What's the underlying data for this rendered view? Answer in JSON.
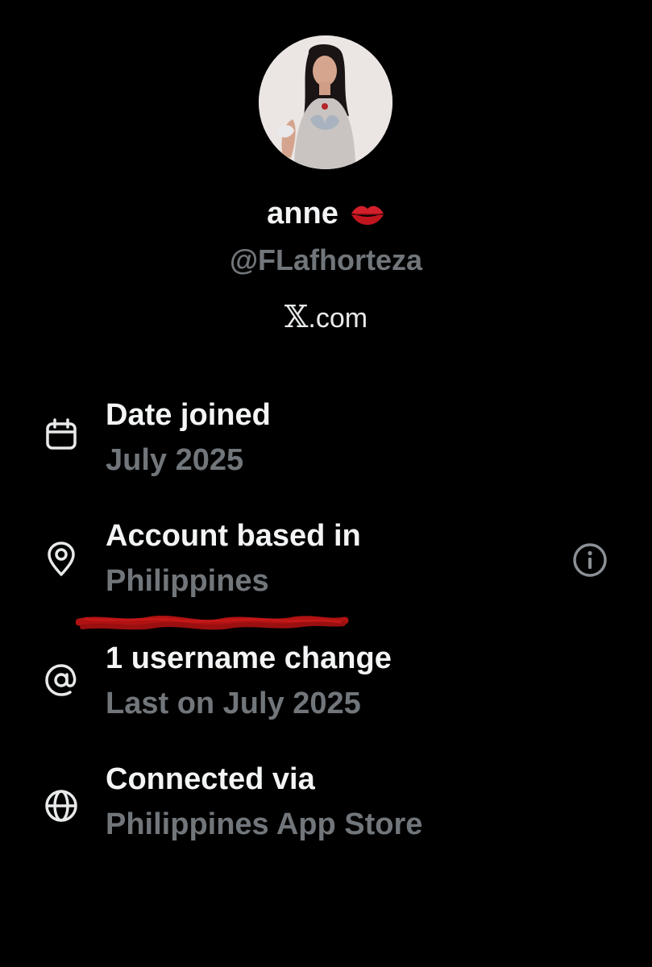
{
  "profile": {
    "display_name": "anne",
    "name_emoji": "kiss-mark-emoji",
    "handle": "@FLafhorteza",
    "site_mark": "𝕏",
    "site_text": ".com"
  },
  "details": [
    {
      "icon": "calendar-icon",
      "label": "Date joined",
      "value": "July 2025"
    },
    {
      "icon": "location-pin-icon",
      "label": "Account based in",
      "value": "Philippines"
    },
    {
      "icon": "at-sign-icon",
      "label": "1 username change",
      "value": "Last on July 2025"
    },
    {
      "icon": "globe-icon",
      "label": "Connected via",
      "value": "Philippines App Store"
    }
  ],
  "colors": {
    "background": "#000000",
    "primary_text": "#e7e9ea",
    "secondary_text": "#71767b",
    "redaction_scribble": "#b01212",
    "emoji_red": "#d21f2a"
  }
}
